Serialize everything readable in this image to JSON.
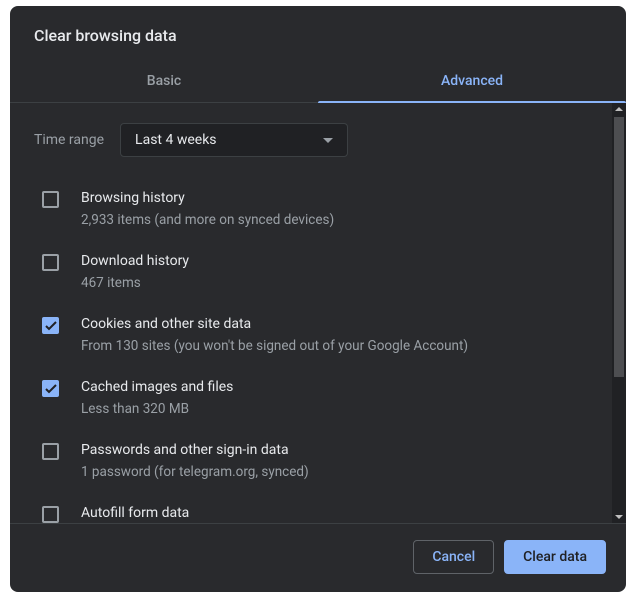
{
  "dialog": {
    "title": "Clear browsing data"
  },
  "tabs": {
    "basic": "Basic",
    "advanced": "Advanced"
  },
  "time": {
    "label": "Time range",
    "value": "Last 4 weeks"
  },
  "items": [
    {
      "title": "Browsing history",
      "sub": "2,933 items (and more on synced devices)",
      "checked": false
    },
    {
      "title": "Download history",
      "sub": "467 items",
      "checked": false
    },
    {
      "title": "Cookies and other site data",
      "sub": "From 130 sites (you won't be signed out of your Google Account)",
      "checked": true
    },
    {
      "title": "Cached images and files",
      "sub": "Less than 320 MB",
      "checked": true
    },
    {
      "title": "Passwords and other sign-in data",
      "sub": "1 password (for telegram.org, synced)",
      "checked": false
    },
    {
      "title": "Autofill form data",
      "sub": "",
      "checked": false
    }
  ],
  "buttons": {
    "cancel": "Cancel",
    "confirm": "Clear data"
  }
}
